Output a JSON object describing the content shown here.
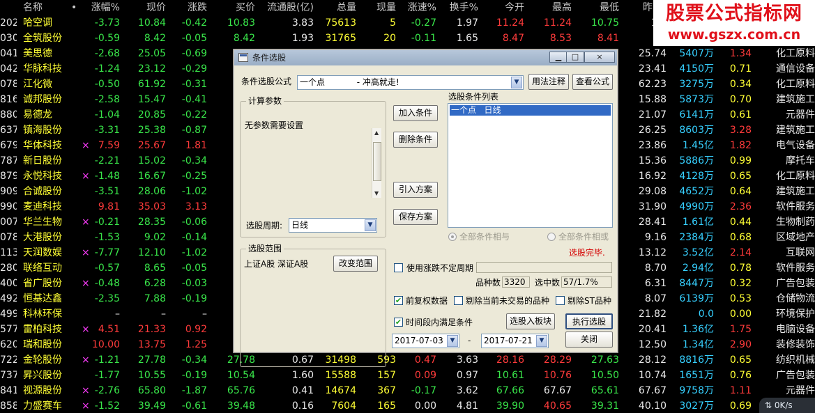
{
  "header": [
    "名称",
    "•",
    "涨幅%",
    "现价",
    "涨跌",
    "买价",
    "流通股(亿)",
    "总量",
    "现量",
    "涨速%",
    "换手%",
    "今开",
    "最高",
    "最低",
    "昨"
  ],
  "rows": [
    {
      "code": "202",
      "name": "哈空调",
      "mark": "",
      "chg_pct": "-3.73",
      "price": "10.84",
      "change": "-0.42",
      "bid": "10.83",
      "float": "3.83",
      "vol": "75613",
      "cur": "5",
      "speed": "-0.27",
      "turn": "1.97",
      "open": "11.24",
      "high": "11.24",
      "low": "10.75",
      "prev": "11.",
      "amount": "",
      "ratio": "",
      "industry": ""
    },
    {
      "code": "030",
      "name": "全筑股份",
      "mark": "",
      "chg_pct": "-0.59",
      "price": "8.42",
      "change": "-0.05",
      "bid": "8.42",
      "float": "1.93",
      "vol": "31765",
      "cur": "20",
      "speed": "-0.11",
      "turn": "1.65",
      "open": "8.47",
      "high": "8.53",
      "low": "8.41",
      "prev": "8.",
      "amount": "",
      "ratio": "",
      "industry": ""
    },
    {
      "code": "041",
      "name": "美思德",
      "mark": "",
      "chg_pct": "-2.68",
      "price": "25.05",
      "change": "-0.69",
      "bid": "2",
      "float": "",
      "vol": "",
      "cur": "",
      "speed": "",
      "turn": "",
      "open": "",
      "high": "",
      "low": "",
      "prev": "25.74",
      "amount": "5407万",
      "ratio": "1.34",
      "industry": "化工原料"
    },
    {
      "code": "042",
      "name": "华脉科技",
      "mark": "",
      "chg_pct": "-1.24",
      "price": "23.12",
      "change": "-0.29",
      "bid": "2",
      "float": "",
      "vol": "",
      "cur": "",
      "speed": "",
      "turn": "",
      "open": "",
      "high": "",
      "low": "",
      "prev": "23.41",
      "amount": "4150万",
      "ratio": "0.71",
      "industry": "通信设备"
    },
    {
      "code": "078",
      "name": "江化微",
      "mark": "",
      "chg_pct": "-0.50",
      "price": "61.92",
      "change": "-0.31",
      "bid": "6",
      "float": "",
      "vol": "",
      "cur": "",
      "speed": "",
      "turn": "",
      "open": "",
      "high": "",
      "low": "",
      "prev": "62.23",
      "amount": "3275万",
      "ratio": "0.34",
      "industry": "化工原料"
    },
    {
      "code": "816",
      "name": "诚邦股份",
      "mark": "",
      "chg_pct": "-2.58",
      "price": "15.47",
      "change": "-0.41",
      "bid": "1",
      "float": "",
      "vol": "",
      "cur": "",
      "speed": "",
      "turn": "",
      "open": "",
      "high": "",
      "low": "",
      "prev": "15.88",
      "amount": "5873万",
      "ratio": "0.70",
      "industry": "建筑施工"
    },
    {
      "code": "880",
      "name": "易德龙",
      "mark": "",
      "chg_pct": "-1.04",
      "price": "20.85",
      "change": "-0.22",
      "bid": "2",
      "float": "",
      "vol": "",
      "cur": "",
      "speed": "",
      "turn": "",
      "open": "",
      "high": "",
      "low": "",
      "prev": "21.07",
      "amount": "6141万",
      "ratio": "0.61",
      "industry": "元器件"
    },
    {
      "code": "637",
      "name": "镇海股份",
      "mark": "",
      "chg_pct": "-3.31",
      "price": "25.38",
      "change": "-0.87",
      "bid": "2",
      "float": "",
      "vol": "",
      "cur": "",
      "speed": "",
      "turn": "",
      "open": "",
      "high": "",
      "low": "",
      "prev": "26.25",
      "amount": "8603万",
      "ratio": "3.28",
      "industry": "建筑施工"
    },
    {
      "code": "679",
      "name": "华体科技",
      "mark": "×",
      "chg_pct": "7.59",
      "price": "25.67",
      "change": "1.81",
      "bid": "2",
      "float": "",
      "vol": "",
      "cur": "",
      "speed": "",
      "turn": "",
      "open": "",
      "high": "",
      "low": "",
      "prev": "23.86",
      "amount": "1.45亿",
      "ratio": "1.82",
      "industry": "电气设备"
    },
    {
      "code": "787",
      "name": "新日股份",
      "mark": "",
      "chg_pct": "-2.21",
      "price": "15.02",
      "change": "-0.34",
      "bid": "1",
      "float": "",
      "vol": "",
      "cur": "",
      "speed": "",
      "turn": "",
      "open": "",
      "high": "",
      "low": "",
      "prev": "15.36",
      "amount": "5886万",
      "ratio": "0.99",
      "industry": "摩托车"
    },
    {
      "code": "879",
      "name": "永悦科技",
      "mark": "×",
      "chg_pct": "-1.48",
      "price": "16.67",
      "change": "-0.25",
      "bid": "1",
      "float": "",
      "vol": "",
      "cur": "",
      "speed": "",
      "turn": "",
      "open": "",
      "high": "",
      "low": "",
      "prev": "16.92",
      "amount": "4128万",
      "ratio": "0.65",
      "industry": "化工原料"
    },
    {
      "code": "909",
      "name": "合诚股份",
      "mark": "",
      "chg_pct": "-3.51",
      "price": "28.06",
      "change": "-1.02",
      "bid": "2",
      "float": "",
      "vol": "",
      "cur": "",
      "speed": "",
      "turn": "",
      "open": "",
      "high": "",
      "low": "",
      "prev": "29.08",
      "amount": "4652万",
      "ratio": "0.64",
      "industry": "建筑施工"
    },
    {
      "code": "990",
      "name": "麦迪科技",
      "mark": "",
      "chg_pct": "9.81",
      "price": "35.03",
      "change": "3.13",
      "bid": "3",
      "float": "",
      "vol": "",
      "cur": "",
      "speed": "",
      "turn": "",
      "open": "",
      "high": "",
      "low": "",
      "prev": "31.90",
      "amount": "4990万",
      "ratio": "2.36",
      "industry": "软件服务"
    },
    {
      "code": "007",
      "name": "华兰生物",
      "mark": "×",
      "chg_pct": "-0.21",
      "price": "28.35",
      "change": "-0.06",
      "bid": "2",
      "float": "",
      "vol": "",
      "cur": "",
      "speed": "",
      "turn": "",
      "open": "",
      "high": "",
      "low": "",
      "prev": "28.41",
      "amount": "1.61亿",
      "ratio": "0.44",
      "industry": "生物制药"
    },
    {
      "code": "078",
      "name": "大港股份",
      "mark": "",
      "chg_pct": "-1.53",
      "price": "9.02",
      "change": "-0.14",
      "bid": "",
      "float": "",
      "vol": "",
      "cur": "",
      "speed": "",
      "turn": "",
      "open": "",
      "high": "",
      "low": "",
      "prev": "9.16",
      "amount": "2384万",
      "ratio": "0.68",
      "industry": "区域地产"
    },
    {
      "code": "113",
      "name": "天润数娱",
      "mark": "×",
      "chg_pct": "-7.77",
      "price": "12.10",
      "change": "-1.02",
      "bid": "1",
      "float": "",
      "vol": "",
      "cur": "",
      "speed": "",
      "turn": "",
      "open": "",
      "high": "",
      "low": "",
      "prev": "13.12",
      "amount": "3.52亿",
      "ratio": "2.14",
      "industry": "互联网"
    },
    {
      "code": "280",
      "name": "联络互动",
      "mark": "",
      "chg_pct": "-0.57",
      "price": "8.65",
      "change": "-0.05",
      "bid": "",
      "float": "",
      "vol": "",
      "cur": "",
      "speed": "",
      "turn": "",
      "open": "",
      "high": "",
      "low": "",
      "prev": "8.70",
      "amount": "2.94亿",
      "ratio": "0.78",
      "industry": "软件服务"
    },
    {
      "code": "400",
      "name": "省广股份",
      "mark": "×",
      "chg_pct": "-0.48",
      "price": "6.28",
      "change": "-0.03",
      "bid": "",
      "float": "",
      "vol": "",
      "cur": "",
      "speed": "",
      "turn": "",
      "open": "",
      "high": "",
      "low": "",
      "prev": "6.31",
      "amount": "8447万",
      "ratio": "0.32",
      "industry": "广告包装"
    },
    {
      "code": "492",
      "name": "恒基达鑫",
      "mark": "",
      "chg_pct": "-2.35",
      "price": "7.88",
      "change": "-0.19",
      "bid": "",
      "float": "",
      "vol": "",
      "cur": "",
      "speed": "",
      "turn": "",
      "open": "",
      "high": "",
      "low": "",
      "prev": "8.07",
      "amount": "6139万",
      "ratio": "0.53",
      "industry": "仓储物流"
    },
    {
      "code": "499",
      "name": "科林环保",
      "mark": "",
      "chg_pct": "–",
      "price": "–",
      "change": "–",
      "bid": "",
      "float": "",
      "vol": "",
      "cur": "",
      "speed": "",
      "turn": "",
      "open": "",
      "high": "",
      "low": "",
      "prev": "21.82",
      "amount": "0.0",
      "ratio": "0.00",
      "industry": "环境保护"
    },
    {
      "code": "577",
      "name": "雷柏科技",
      "mark": "×",
      "chg_pct": "4.51",
      "price": "21.33",
      "change": "0.92",
      "bid": "2",
      "float": "",
      "vol": "",
      "cur": "",
      "speed": "",
      "turn": "",
      "open": "",
      "high": "",
      "low": "",
      "prev": "20.41",
      "amount": "1.36亿",
      "ratio": "1.75",
      "industry": "电脑设备"
    },
    {
      "code": "620",
      "name": "瑞和股份",
      "mark": "",
      "chg_pct": "10.00",
      "price": "13.75",
      "change": "1.25",
      "bid": "1",
      "float": "",
      "vol": "",
      "cur": "",
      "speed": "",
      "turn": "",
      "open": "",
      "high": "",
      "low": "",
      "prev": "12.50",
      "amount": "1.34亿",
      "ratio": "2.90",
      "industry": "装修装饰"
    },
    {
      "code": "722",
      "name": "金轮股份",
      "mark": "×",
      "chg_pct": "-1.21",
      "price": "27.78",
      "change": "-0.34",
      "bid": "27.78",
      "float": "0.67",
      "vol": "31498",
      "cur": "593",
      "speed": "0.47",
      "turn": "3.63",
      "open": "28.16",
      "high": "28.29",
      "low": "27.63",
      "prev": "28.12",
      "amount": "8816万",
      "ratio": "0.65",
      "industry": "纺织机械"
    },
    {
      "code": "737",
      "name": "昇兴股份",
      "mark": "",
      "chg_pct": "-1.77",
      "price": "10.55",
      "change": "-0.19",
      "bid": "10.54",
      "float": "1.60",
      "vol": "15588",
      "cur": "157",
      "speed": "0.09",
      "turn": "0.97",
      "open": "10.61",
      "high": "10.76",
      "low": "10.50",
      "prev": "10.74",
      "amount": "1651万",
      "ratio": "0.76",
      "industry": "广告包装"
    },
    {
      "code": "841",
      "name": "视源股份",
      "mark": "×",
      "chg_pct": "-2.76",
      "price": "65.80",
      "change": "-1.87",
      "bid": "65.76",
      "float": "0.41",
      "vol": "14674",
      "cur": "367",
      "speed": "-0.17",
      "turn": "3.62",
      "open": "67.66",
      "high": "67.67",
      "low": "65.61",
      "prev": "67.67",
      "amount": "9758万",
      "ratio": "1.11",
      "industry": "元器件"
    },
    {
      "code": "858",
      "name": "力盛赛车",
      "mark": "×",
      "chg_pct": "-1.52",
      "price": "39.49",
      "change": "-0.61",
      "bid": "39.48",
      "float": "0.16",
      "vol": "7604",
      "cur": "165",
      "speed": "0.00",
      "turn": "4.81",
      "open": "39.90",
      "high": "40.65",
      "low": "39.31",
      "prev": "40.10",
      "amount": "3027万",
      "ratio": "0.69",
      "industry": ""
    }
  ],
  "watermark": {
    "title": "股票公式指标网",
    "url": "www.gszx.com.cn"
  },
  "net_speed": "0K/s",
  "net_speed_icon": "network-icon",
  "dialog": {
    "title": "条件选股",
    "buttons_title": {
      "minimize": "▁",
      "maximize": "□",
      "close": "×"
    },
    "formula_label": "条件选股公式",
    "formula_value": "一个点            - 冲高就走!",
    "usage_button": "用法注释",
    "view_button": "查看公式",
    "params_group": "计算参数",
    "params_text": "无参数需要设置",
    "period_label": "选股周期:",
    "period_value": "日线",
    "add_button": "加入条件",
    "delete_button": "删除条件",
    "import_button": "引入方案",
    "save_button": "保存方案",
    "list_label": "选股条件列表",
    "list_items": [
      "一个点   日线"
    ],
    "radio_and": "全部条件相与",
    "radio_or": "全部条件相或",
    "status": "选股完毕.",
    "range_group": "选股范围",
    "range_text": "上证A股 深证A股",
    "range_button": "改变范围",
    "use_period_label": "使用涨跌不定周期",
    "count_label": "品种数",
    "count_value": "3320",
    "selected_label": "选中数",
    "selected_value": "57/1.7%",
    "pre_adjust_label": "前复权数据",
    "exclude_untraded_label": "剔除当前未交易的品种",
    "exclude_st_label": "剔除ST品种",
    "time_range_label": "时间段内满足条件",
    "add_to_block_button": "选股入板块",
    "execute_button": "执行选股",
    "date_from": "2017-07-03",
    "date_sep": "-",
    "date_to": "2017-07-21",
    "close_button": "关闭"
  },
  "colors": {
    "up": "#ff3b3b",
    "down": "#39e64a",
    "name": "#ffff35",
    "amount": "#36d0ff",
    "dialog_bg": "#ece9d8",
    "selection": "#316ac5"
  }
}
